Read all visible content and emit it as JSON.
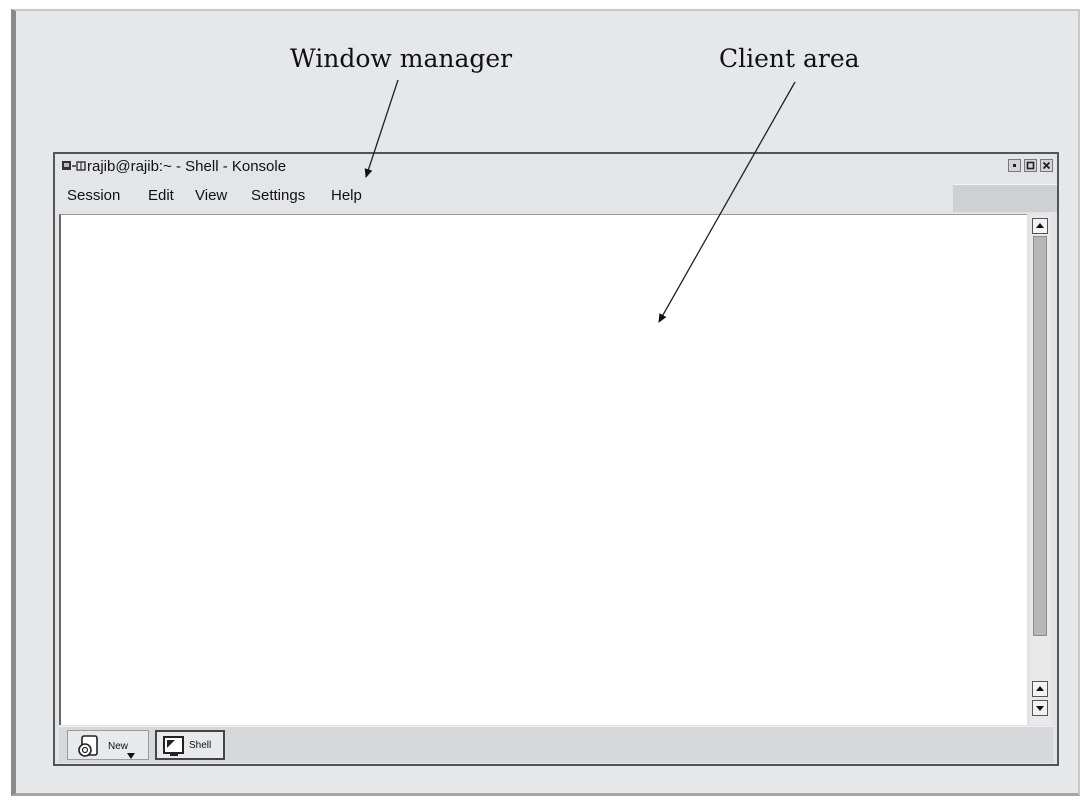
{
  "callouts": {
    "window_manager": "Window manager",
    "client_area": "Client area"
  },
  "window": {
    "title": "rajib@rajib:~ - Shell - Konsole",
    "menu": [
      "Session",
      "Edit",
      "View",
      "Settings",
      "Help"
    ]
  },
  "tabs": [
    {
      "label": "New",
      "icon": "new-session-icon"
    },
    {
      "label": "Shell",
      "icon": "terminal-icon"
    }
  ],
  "window_buttons": [
    "minimize-icon",
    "maximize-icon",
    "close-icon"
  ],
  "colors": {
    "frame_bg": "#e6e7e8",
    "client_bg": "#ffffff",
    "scroll_thumb": "#b7b7b7"
  }
}
